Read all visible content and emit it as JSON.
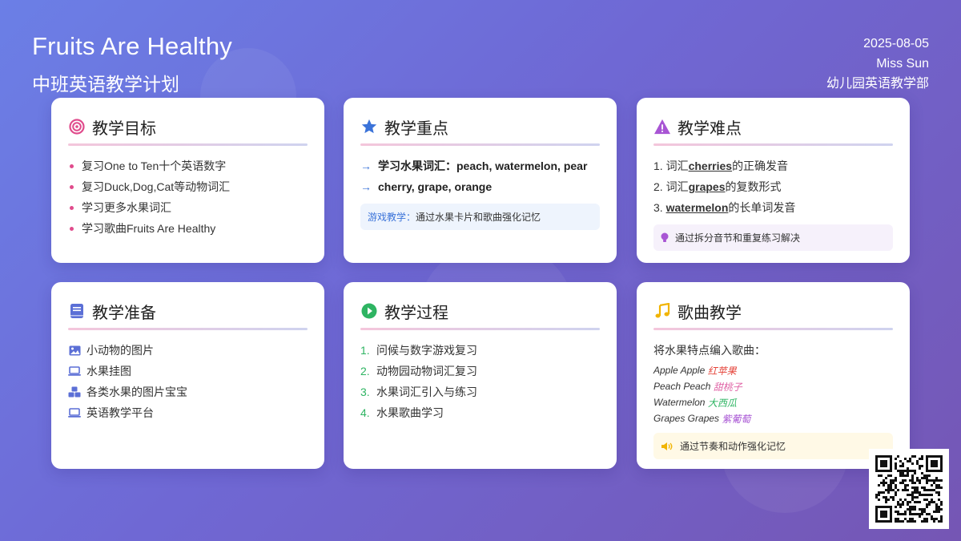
{
  "header": {
    "title": "Fruits Are Healthy",
    "subtitle": "中班英语教学计划",
    "date": "2025-08-05",
    "teacher": "Miss Sun",
    "department": "幼儿园英语教学部"
  },
  "goals": {
    "title": "教学目标",
    "icon": "target-icon",
    "items": [
      "复习One to Ten十个英语数字",
      "复习Duck,Dog,Cat等动物词汇",
      "学习更多水果词汇",
      "学习歌曲Fruits Are Healthy"
    ]
  },
  "keypoints": {
    "title": "教学重点",
    "icon": "star-icon",
    "items": [
      "学习水果词汇：peach, watermelon, pear",
      "cherry, grape, orange"
    ],
    "note_label": "游戏教学：",
    "note_text": "通过水果卡片和歌曲强化记忆"
  },
  "difficulties": {
    "title": "教学难点",
    "icon": "warning-icon",
    "items": [
      {
        "num": "1.",
        "pre": "词汇",
        "word": "cherries",
        "post": "的正确发音"
      },
      {
        "num": "2.",
        "pre": "词汇",
        "word": "grapes",
        "post": "的复数形式"
      },
      {
        "num": "3.",
        "pre": "",
        "word": "watermelon",
        "post": "的长单词发音"
      }
    ],
    "note_text": "通过拆分音节和重复练习解决"
  },
  "preparation": {
    "title": "教学准备",
    "icon": "book-icon",
    "items": [
      {
        "icon": "image-icon",
        "text": "小动物的图片"
      },
      {
        "icon": "laptop-icon",
        "text": "水果挂图"
      },
      {
        "icon": "cubes-icon",
        "text": "各类水果的图片宝宝"
      },
      {
        "icon": "laptop-icon",
        "text": "英语教学平台"
      }
    ]
  },
  "process": {
    "title": "教学过程",
    "icon": "play-icon",
    "items": [
      {
        "num": "1.",
        "text": "问候与数字游戏复习"
      },
      {
        "num": "2.",
        "text": "动物园动物词汇复习"
      },
      {
        "num": "3.",
        "text": "水果词汇引入与练习"
      },
      {
        "num": "4.",
        "text": "水果歌曲学习"
      }
    ]
  },
  "song": {
    "title": "歌曲教学",
    "icon": "music-icon",
    "intro": "将水果特点编入歌曲：",
    "lines": [
      {
        "en": "Apple Apple",
        "zh": "红苹果",
        "color": "#e5453b"
      },
      {
        "en": "Peach Peach",
        "zh": "甜桃子",
        "color": "#e064a6"
      },
      {
        "en": "Watermelon",
        "zh": "大西瓜",
        "color": "#2eb462"
      },
      {
        "en": "Grapes Grapes",
        "zh": "紫葡萄",
        "color": "#a855d4"
      }
    ],
    "note_text": "通过节奏和动作强化记忆"
  },
  "colors": {
    "pink": "#e04b8c",
    "blue": "#3b73d9",
    "purple": "#a855d4",
    "green": "#2eb462",
    "yellow": "#f1b400",
    "indigo": "#5b6fd6"
  }
}
